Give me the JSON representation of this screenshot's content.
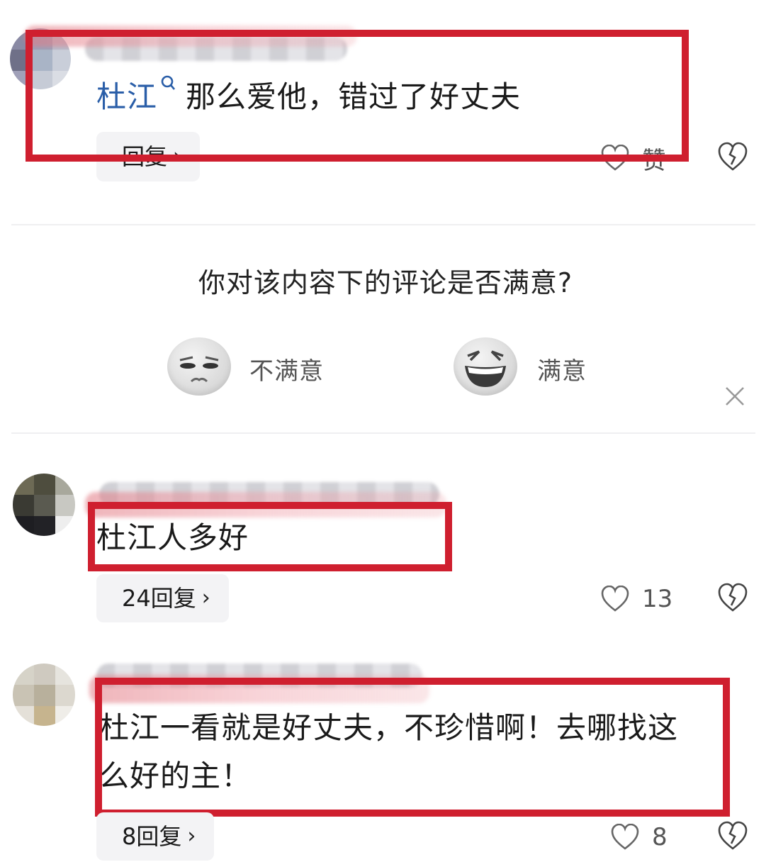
{
  "comments": [
    {
      "mention": "杜江",
      "text": "那么爱他，错过了好丈夫",
      "reply_label": "回复",
      "like_label": "赞"
    },
    {
      "text": "杜江人多好",
      "reply_label": "24回复",
      "like_count": "13"
    },
    {
      "text_line1": "杜江一看就是好丈夫，不珍惜啊！去哪找这",
      "text_line2": "么好的主！",
      "reply_label": "8回复",
      "like_count": "8"
    }
  ],
  "survey": {
    "question": "你对该内容下的评论是否满意?",
    "unsatisfied_label": "不满意",
    "satisfied_label": "满意"
  },
  "icons": {
    "like": "heart-outline-icon",
    "dislike": "broken-heart-icon",
    "search": "search-icon",
    "close": "close-icon",
    "chevron": "chevron-right-icon"
  },
  "colors": {
    "highlight_box": "#cf1f2f",
    "mention": "#2a5ea8",
    "pill_bg": "#f3f3f5"
  }
}
